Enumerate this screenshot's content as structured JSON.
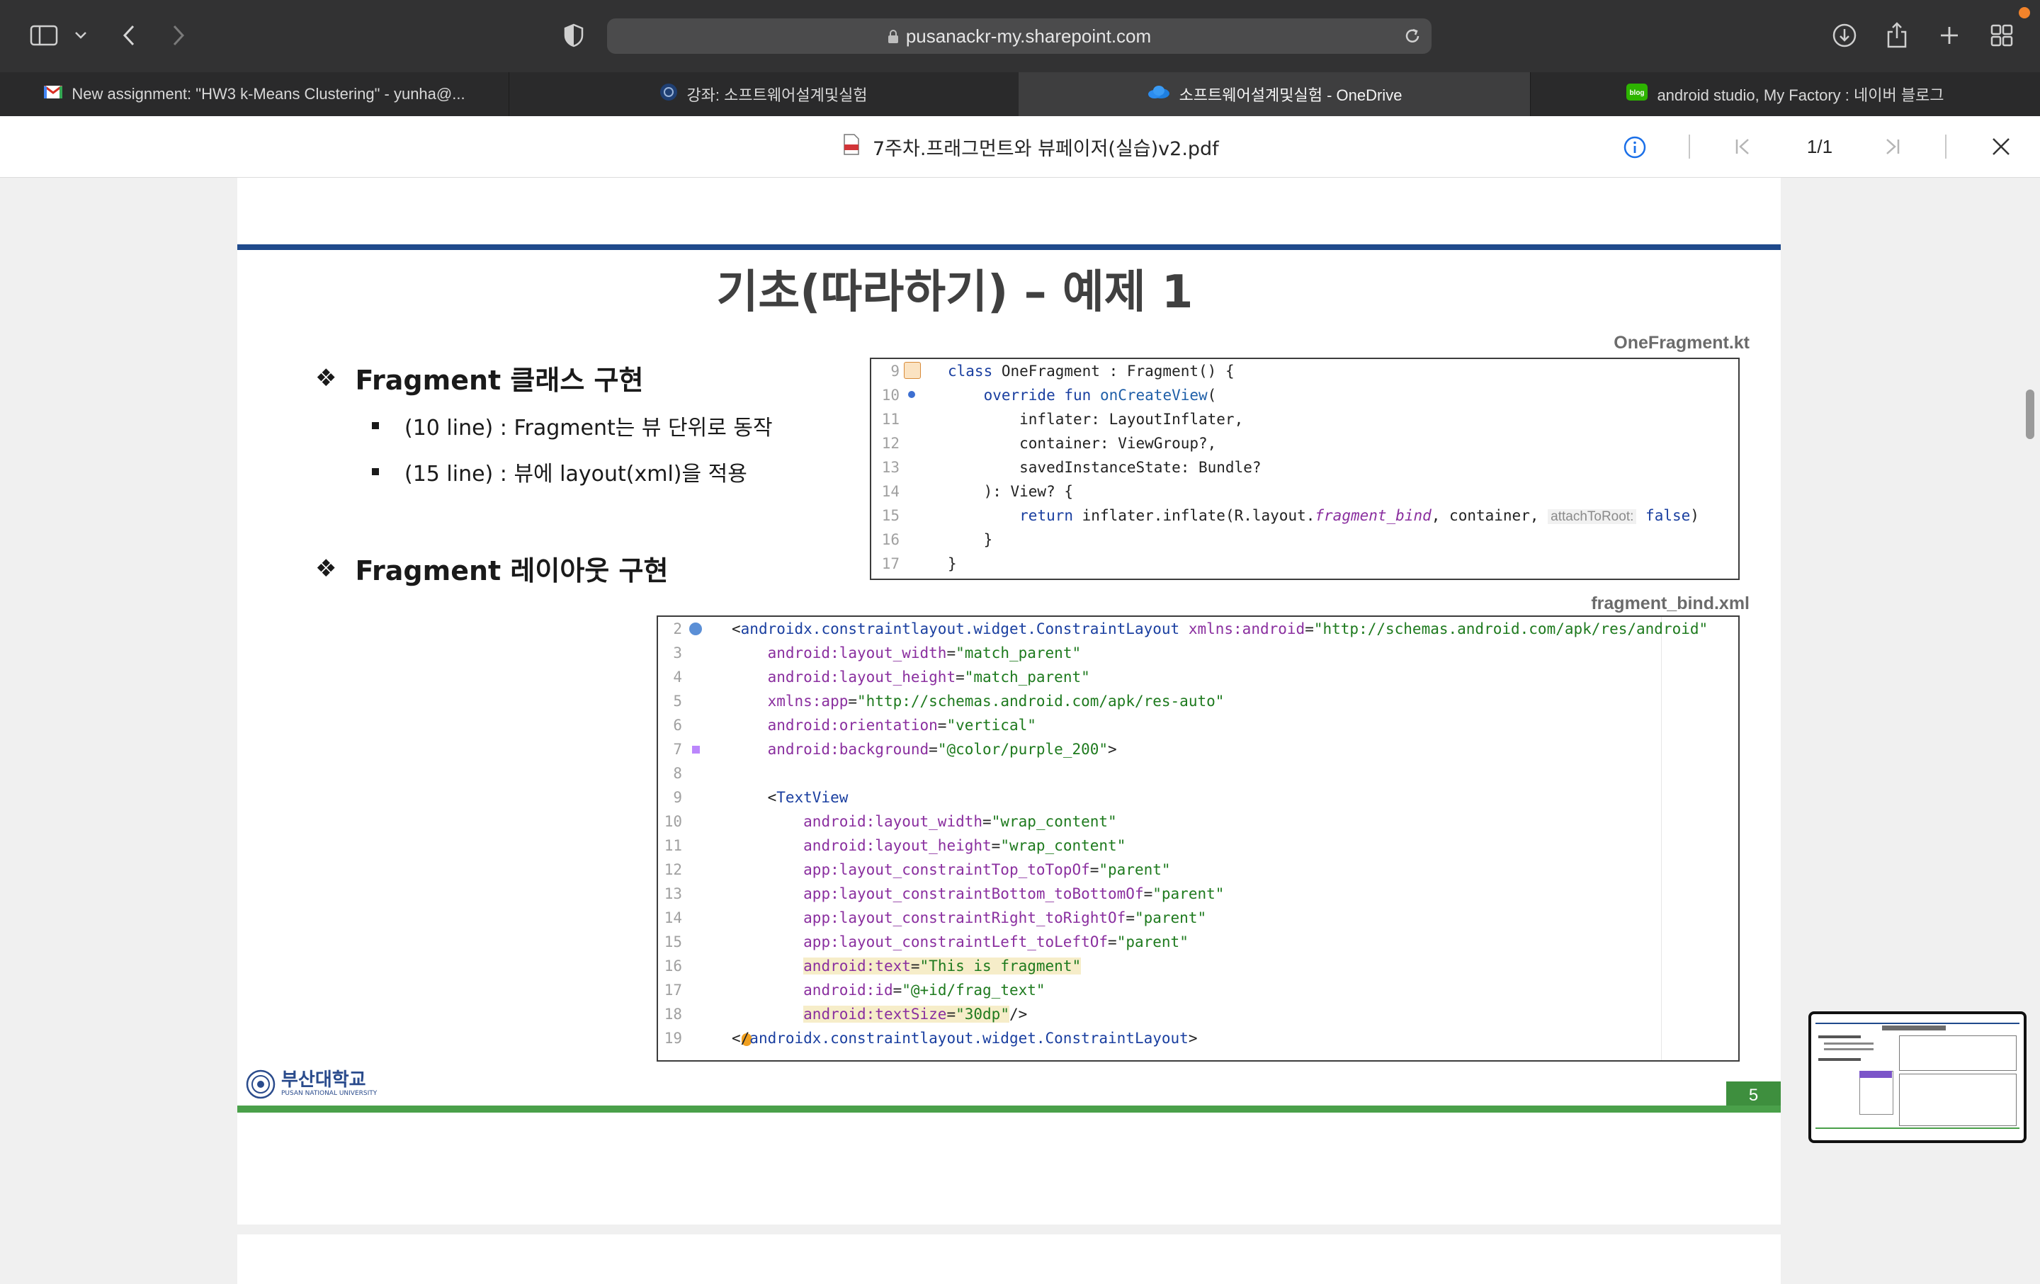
{
  "browser": {
    "url": "pusanackr-my.sharepoint.com",
    "tabs": [
      {
        "label": "New assignment: \"HW3 k-Means Clustering\" - yunha@...",
        "icon": "gmail-icon",
        "active": false
      },
      {
        "label": "강좌: 소프트웨어설계및실험",
        "icon": "course-icon",
        "active": false
      },
      {
        "label": "소프트웨어설계및실험 - OneDrive",
        "icon": "onedrive-icon",
        "active": true
      },
      {
        "label": "android studio, My Factory : 네이버 블로그",
        "icon": "blog-icon",
        "active": false
      }
    ]
  },
  "viewer": {
    "file_name": "7주차.프래그먼트와 뷰페이저(실습)v2.pdf",
    "page_indicator": "1/1"
  },
  "slide": {
    "title": "기초(따라하기) – 예제 1",
    "section1": {
      "heading": "Fragment 클래스 구현",
      "items": [
        "(10 line) : Fragment는 뷰 단위로 동작",
        "(15 line) : 뷰에 layout(xml)을 적용"
      ]
    },
    "section2": {
      "heading": "Fragment 레이아웃 구현"
    },
    "kotlin_file": "OneFragment.kt",
    "kotlin_lines": [
      {
        "n": "9",
        "text": "class OneFragment : Fragment() {"
      },
      {
        "n": "10",
        "text": "    override fun onCreateView("
      },
      {
        "n": "11",
        "text": "        inflater: LayoutInflater,"
      },
      {
        "n": "12",
        "text": "        container: ViewGroup?,"
      },
      {
        "n": "13",
        "text": "        savedInstanceState: Bundle?"
      },
      {
        "n": "14",
        "text": "    ): View? {"
      },
      {
        "n": "15",
        "text": "        return inflater.inflate(R.layout.fragment_bind, container, attachToRoot: false)"
      },
      {
        "n": "16",
        "text": "    }"
      },
      {
        "n": "17",
        "text": "}"
      }
    ],
    "xml_file": "fragment_bind.xml",
    "xml_lines": [
      {
        "n": "2",
        "text": "<androidx.constraintlayout.widget.ConstraintLayout xmlns:android=\"http://schemas.android.com/apk/res/android\""
      },
      {
        "n": "3",
        "text": "    android:layout_width=\"match_parent\""
      },
      {
        "n": "4",
        "text": "    android:layout_height=\"match_parent\""
      },
      {
        "n": "5",
        "text": "    xmlns:app=\"http://schemas.android.com/apk/res-auto\""
      },
      {
        "n": "6",
        "text": "    android:orientation=\"vertical\""
      },
      {
        "n": "7",
        "text": "    android:background=\"@color/purple_200\">"
      },
      {
        "n": "8",
        "text": ""
      },
      {
        "n": "9",
        "text": "    <TextView"
      },
      {
        "n": "10",
        "text": "        android:layout_width=\"wrap_content\""
      },
      {
        "n": "11",
        "text": "        android:layout_height=\"wrap_content\""
      },
      {
        "n": "12",
        "text": "        app:layout_constraintTop_toTopOf=\"parent\""
      },
      {
        "n": "13",
        "text": "        app:layout_constraintBottom_toBottomOf=\"parent\""
      },
      {
        "n": "14",
        "text": "        app:layout_constraintRight_toRightOf=\"parent\""
      },
      {
        "n": "15",
        "text": "        app:layout_constraintLeft_toLeftOf=\"parent\""
      },
      {
        "n": "16",
        "text": "        android:text=\"This is fragment\""
      },
      {
        "n": "17",
        "text": "        android:id=\"@+id/frag_text\""
      },
      {
        "n": "18",
        "text": "        android:textSize=\"30dp\"/>"
      },
      {
        "n": "19",
        "text": "</androidx.constraintlayout.widget.ConstraintLayout>"
      }
    ],
    "page_number": "5",
    "logo_ko": "부산대학교",
    "logo_en": "PUSAN NATIONAL UNIVERSITY"
  },
  "colors": {
    "title_bar": "#1f4a8c",
    "footer_bar": "#4aa04a",
    "toolbar": "#323233"
  }
}
